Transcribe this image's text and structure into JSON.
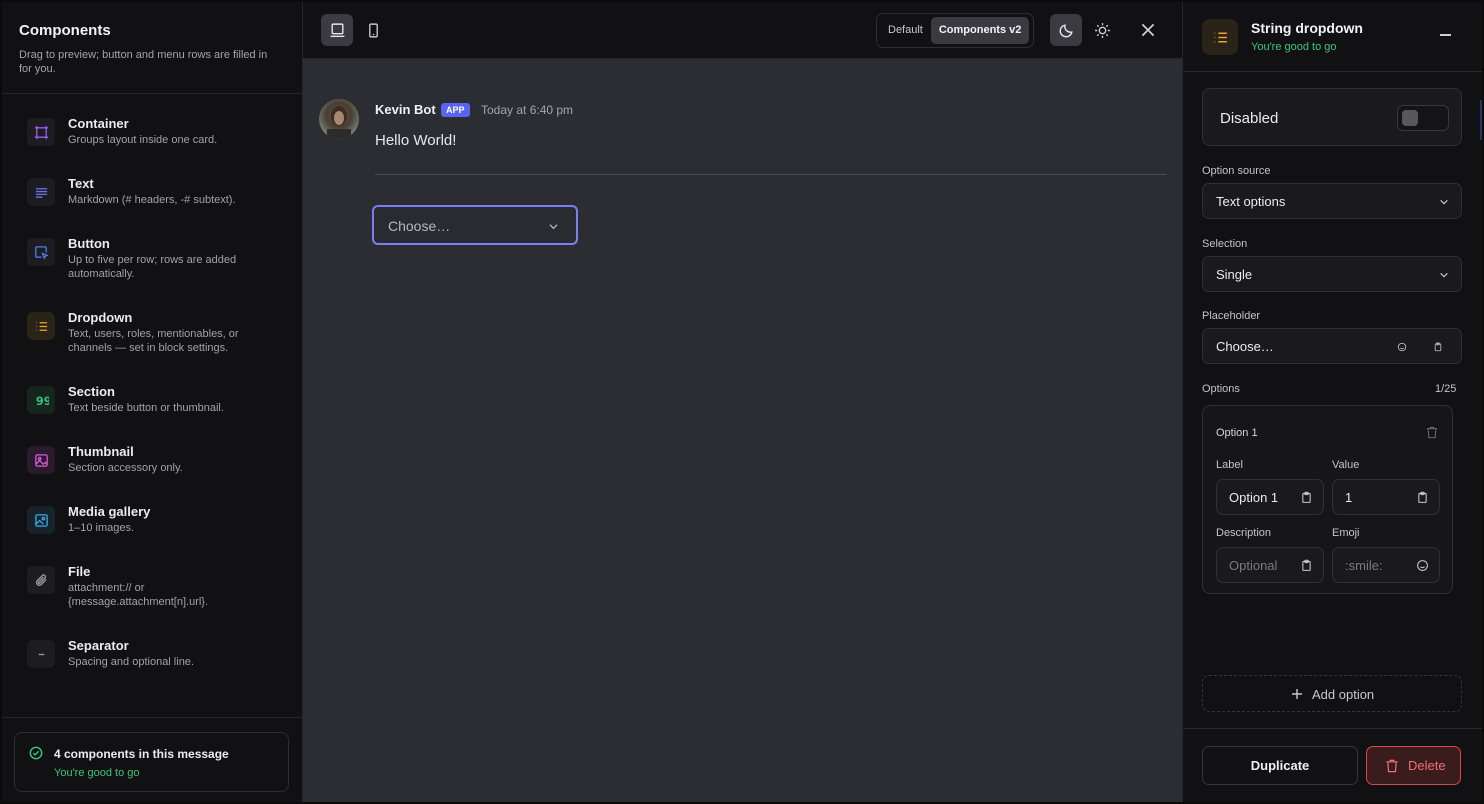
{
  "sidebar": {
    "title": "Components",
    "subtitle": "Drag to preview; button and menu rows are filled in for you.",
    "items": [
      {
        "name": "Container",
        "desc": "Groups layout inside one card.",
        "icon": "container-icon",
        "color": "#9b5cf0"
      },
      {
        "name": "Text",
        "desc": "Markdown (# headers, -# subtext).",
        "icon": "text-lines-icon",
        "color": "#6b6ff0"
      },
      {
        "name": "Button",
        "desc": "Up to five per row; rows are added automatically.",
        "icon": "button-cursor-icon",
        "color": "#4f7ef0"
      },
      {
        "name": "Dropdown",
        "desc": "Text, users, roles, mentionables, or channels — set in block settings.",
        "icon": "list-icon",
        "color": "#e8a230"
      },
      {
        "name": "Section",
        "desc": "Text beside button or thumbnail.",
        "icon": "quote-icon",
        "color": "#31c27a"
      },
      {
        "name": "Thumbnail",
        "desc": "Section accessory only.",
        "icon": "image-icon",
        "color": "#d35bd8"
      },
      {
        "name": "Media gallery",
        "desc": "1–10 images.",
        "icon": "gallery-icon",
        "color": "#3aa8e8"
      },
      {
        "name": "File",
        "desc": "attachment:// or {message.attachment[n].url}.",
        "icon": "paperclip-icon",
        "color": "#9a9aa0"
      },
      {
        "name": "Separator",
        "desc": "Spacing and optional line.",
        "icon": "minus-icon",
        "color": "#9a9aa0"
      }
    ],
    "footer": {
      "title": "4 components in this message",
      "status": "You're good to go"
    }
  },
  "topbar": {
    "segments": [
      "Default",
      "Components v2"
    ],
    "active_segment": "Components v2"
  },
  "message": {
    "author": "Kevin Bot",
    "badge": "APP",
    "time": "Today at 6:40 pm",
    "text": "Hello World!",
    "select_placeholder": "Choose…"
  },
  "panel": {
    "title": "String dropdown",
    "status": "You're good to go",
    "disabled_label": "Disabled",
    "option_source_label": "Option source",
    "option_source_value": "Text options",
    "selection_label": "Selection",
    "selection_value": "Single",
    "placeholder_label": "Placeholder",
    "placeholder_value": "Choose…",
    "options_label": "Options",
    "options_count": "1/25",
    "option": {
      "title": "Option 1",
      "label_label": "Label",
      "label_value": "Option 1",
      "value_label": "Value",
      "value_value": "1",
      "description_label": "Description",
      "description_placeholder": "Optional",
      "emoji_label": "Emoji",
      "emoji_placeholder": ":smile:"
    },
    "add_option": "Add option",
    "duplicate": "Duplicate",
    "delete": "Delete"
  },
  "colors": {
    "accent": "#5865f2",
    "success": "#3fc47c",
    "danger": "#d94848",
    "focus": "#7a7ff5"
  }
}
